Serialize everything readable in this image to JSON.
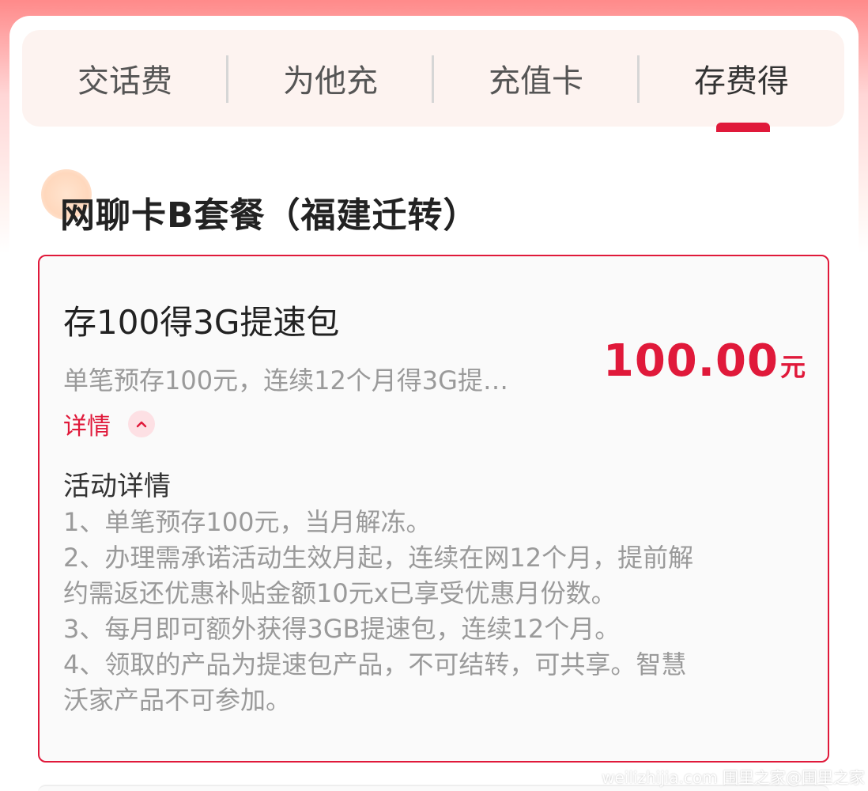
{
  "tabs": [
    {
      "label": "交话费"
    },
    {
      "label": "为他充"
    },
    {
      "label": "充值卡"
    },
    {
      "label": "存费得"
    }
  ],
  "active_tab": "存费得",
  "plan": {
    "title": "网聊卡B套餐（福建迁转）"
  },
  "offer": {
    "title": "存100得3G提速包",
    "subtitle": "单笔预存100元，连续12个月得3G提…",
    "price": "100.00",
    "price_unit": "元",
    "detail_toggle": "详情",
    "chevron_icon": "chevron-up-icon"
  },
  "activity": {
    "heading": "活动详情",
    "lines": [
      "1、单笔预存100元，当月解冻。",
      "2、办理需承诺活动生效月起，连续在网12个月，提前解",
      "约需返还优惠补贴金额10元x已享受优惠月份数。",
      "3、每月即可额外获得3GB提速包，连续12个月。",
      "4、领取的产品为提速包产品，不可结转，可共享。智慧",
      "沃家产品不可参加。"
    ]
  },
  "watermark": "weilizhijia.com 围里之家@围里之家",
  "colors": {
    "accent": "#e0193a",
    "tab_bg": "#fdf3f0",
    "muted_text": "#9a9a9a"
  }
}
